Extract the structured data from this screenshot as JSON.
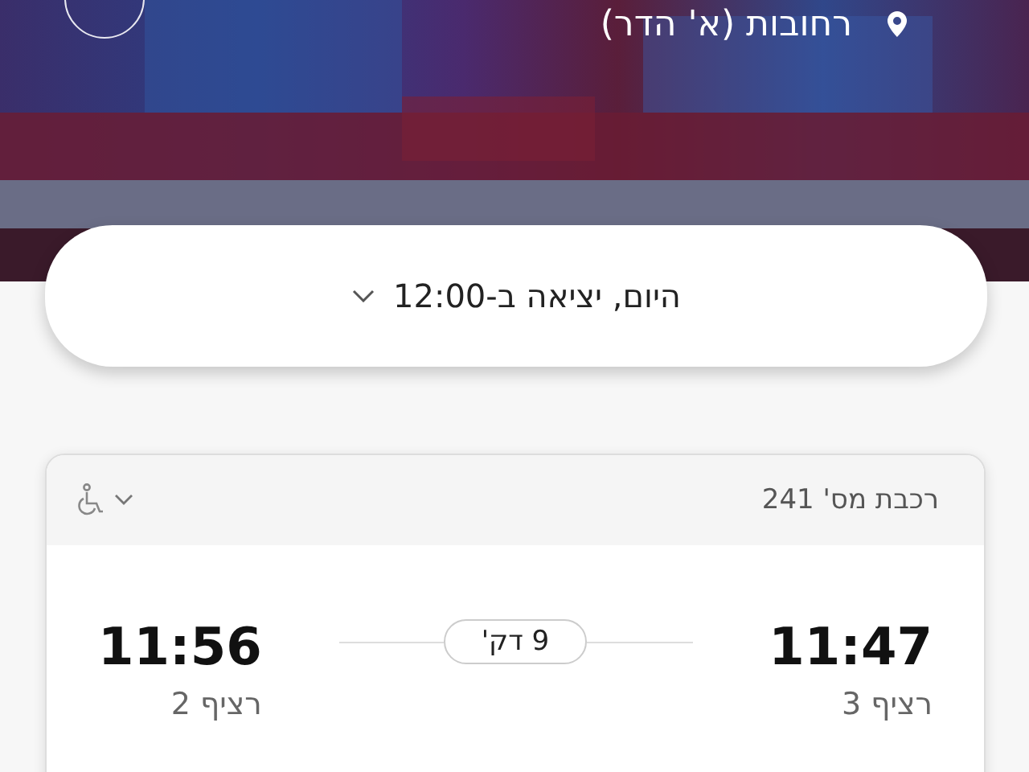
{
  "header": {
    "location": "רחובות (א' הדר)"
  },
  "departure": {
    "label": "היום, יציאה ב-12:00"
  },
  "trip": {
    "train": "רכבת מס' 241",
    "accessible": true,
    "expanded": false,
    "from": {
      "time": "11:47",
      "platform": "רציף 3"
    },
    "duration": "9 דק'",
    "to": {
      "time": "11:56",
      "platform": "רציף 2"
    }
  }
}
